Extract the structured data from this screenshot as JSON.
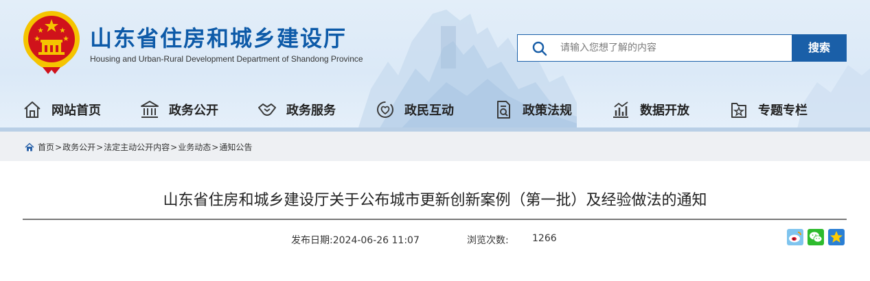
{
  "header": {
    "title": "山东省住房和城乡建设厅",
    "subtitle": "Housing and Urban-Rural Development Department of Shandong Province",
    "emblem_icon": "national-emblem-icon",
    "colors": {
      "brand_blue": "#0d5aa8",
      "search_blue": "#1a5fa8",
      "emblem_red": "#d0121b",
      "emblem_gold": "#f5c400"
    }
  },
  "search": {
    "placeholder": "请输入您想了解的内容",
    "value": "",
    "button_label": "搜索",
    "icon": "search-icon"
  },
  "nav": {
    "items": [
      {
        "label": "网站首页",
        "icon": "home-icon"
      },
      {
        "label": "政务公开",
        "icon": "government-building-icon"
      },
      {
        "label": "政务服务",
        "icon": "handshake-icon"
      },
      {
        "label": "政民互动",
        "icon": "interaction-icon"
      },
      {
        "label": "政策法规",
        "icon": "policy-document-icon"
      },
      {
        "label": "数据开放",
        "icon": "bar-chart-icon"
      },
      {
        "label": "专题专栏",
        "icon": "star-folder-icon"
      }
    ]
  },
  "breadcrumb": {
    "icon": "home-icon",
    "items": [
      "首页",
      "政务公开",
      "法定主动公开内容",
      "业务动态",
      "通知公告"
    ],
    "separator": ">"
  },
  "article": {
    "title": "山东省住房和城乡建设厅关于公布城市更新创新案例（第一批）及经验做法的通知",
    "publish_text": "发布日期:2024-06-26 11:07",
    "views_label": "浏览次数:",
    "views_count": "1266"
  },
  "share": {
    "items": [
      {
        "icon": "weibo-icon"
      },
      {
        "icon": "wechat-icon"
      },
      {
        "icon": "qzone-star-icon"
      }
    ]
  }
}
